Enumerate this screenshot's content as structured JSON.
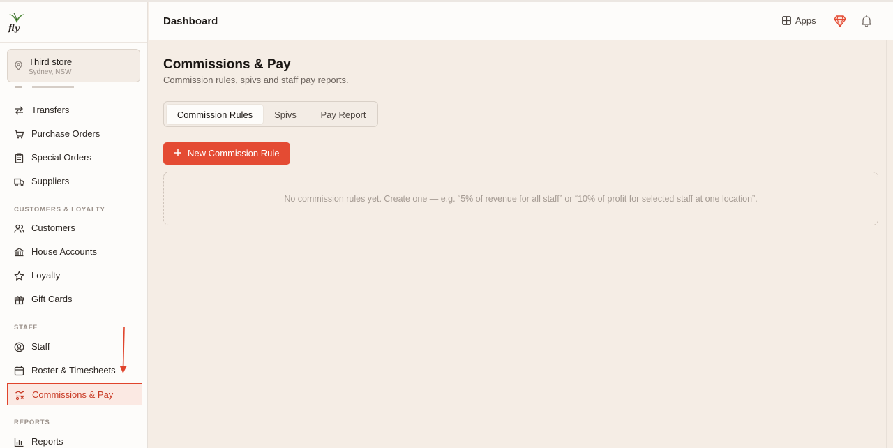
{
  "brand": {
    "logo_text": "fly"
  },
  "store": {
    "name": "Third store",
    "location": "Sydney, NSW"
  },
  "sidebar": {
    "items_top": [
      {
        "label": "Transfers",
        "icon": "arrows-swap-icon"
      },
      {
        "label": "Purchase Orders",
        "icon": "cart-icon"
      },
      {
        "label": "Special Orders",
        "icon": "clipboard-icon"
      },
      {
        "label": "Suppliers",
        "icon": "truck-icon"
      }
    ],
    "section_customers": "CUSTOMERS & LOYALTY",
    "items_customers": [
      {
        "label": "Customers",
        "icon": "users-icon"
      },
      {
        "label": "House Accounts",
        "icon": "bank-icon"
      },
      {
        "label": "Loyalty",
        "icon": "star-icon"
      },
      {
        "label": "Gift Cards",
        "icon": "gift-icon"
      }
    ],
    "section_staff": "STAFF",
    "items_staff": [
      {
        "label": "Staff",
        "icon": "user-circle-icon"
      },
      {
        "label": "Roster & Timesheets",
        "icon": "calendar-icon"
      },
      {
        "label": "Commissions & Pay",
        "icon": "commission-icon",
        "active": true
      }
    ],
    "section_reports": "REPORTS",
    "items_reports": [
      {
        "label": "Reports",
        "icon": "bar-chart-icon"
      }
    ]
  },
  "header": {
    "title": "Dashboard",
    "apps_label": "Apps"
  },
  "main": {
    "title": "Commissions & Pay",
    "subtitle": "Commission rules, spivs and staff pay reports.",
    "tabs": [
      {
        "label": "Commission Rules",
        "active": true
      },
      {
        "label": "Spivs"
      },
      {
        "label": "Pay Report"
      }
    ],
    "new_button_label": "New Commission Rule",
    "empty_state": "No commission rules yet. Create one — e.g. “5% of revenue for all staff” or “10% of profit for selected staff at one location”."
  },
  "colors": {
    "accent": "#e44b33",
    "highlight_border": "#e0442c",
    "background": "#f5ede5",
    "sidebar_bg": "#fdfcfa"
  }
}
